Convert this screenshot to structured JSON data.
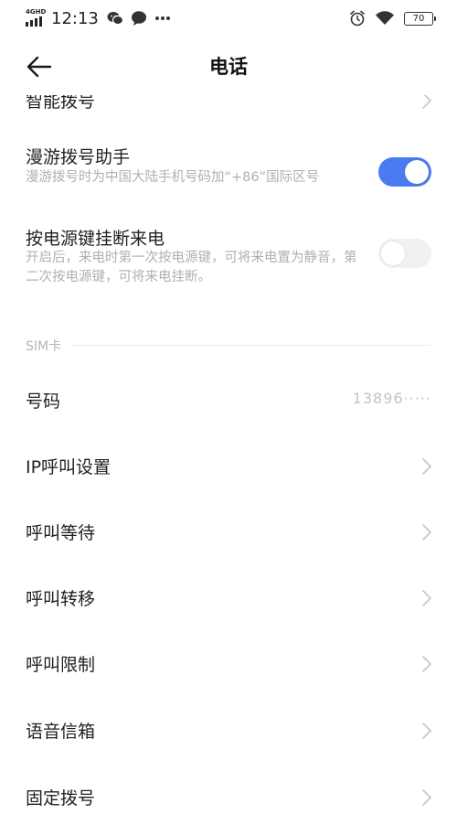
{
  "status_bar": {
    "network": "4GHD",
    "time": "12:13",
    "battery": "70"
  },
  "header": {
    "title": "电话"
  },
  "rows": {
    "partial_label": "智能拨号",
    "roaming_title": "漫游拨号助手",
    "roaming_desc": "漫游拨号时为中国大陆手机号码加“+86”国际区号",
    "roaming_enabled": true,
    "power_title": "按电源键挂断来电",
    "power_desc": "开启后，来电时第一次按电源键，可将来电置为静音，第二次按电源键，可将来电挂断。",
    "power_enabled": false
  },
  "sim_section": {
    "label": "SIM卡",
    "number_label": "号码",
    "number_value": "13896·····"
  },
  "menu": [
    {
      "label": "IP呼叫设置"
    },
    {
      "label": "呼叫等待"
    },
    {
      "label": "呼叫转移"
    },
    {
      "label": "呼叫限制"
    },
    {
      "label": "语音信箱"
    },
    {
      "label": "固定拨号"
    }
  ],
  "colors": {
    "accent": "#4a7bf0",
    "secondary_text": "#b0b0b0"
  }
}
